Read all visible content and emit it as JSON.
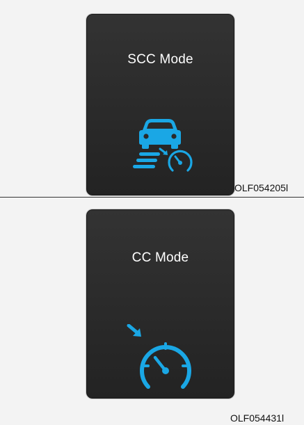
{
  "figures": [
    {
      "title": "SCC Mode",
      "icon": "scc-smart-cruise-control-icon",
      "code": "OLF054205l"
    },
    {
      "title": "CC Mode",
      "icon": "cc-cruise-control-icon",
      "code": "OLF054431l"
    }
  ],
  "colors": {
    "background": "#f3f3f3",
    "display": "#2d2d2d",
    "title_text": "#ffffff",
    "icon_blue": "#1aa7e5"
  }
}
